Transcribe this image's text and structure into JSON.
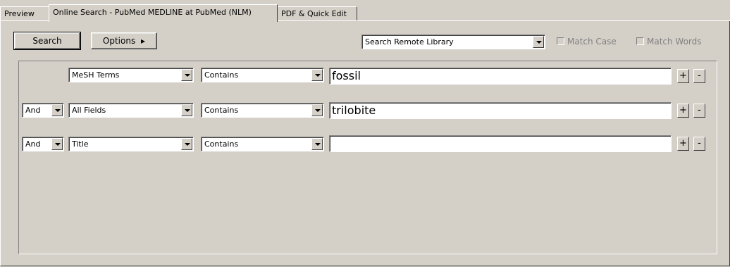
{
  "tabs": [
    {
      "label": "Preview"
    },
    {
      "label": "Online Search - PubMed MEDLINE at PubMed (NLM)",
      "active": true
    },
    {
      "label": "PDF & Quick Edit"
    }
  ],
  "toolbar": {
    "search_label": "Search",
    "options_label": "Options",
    "options_arrow": "▸",
    "library_select": "Search Remote Library",
    "match_case_label": "Match Case",
    "match_words_label": "Match Words"
  },
  "rows": [
    {
      "bool": "",
      "field": "MeSH Terms",
      "operator": "Contains",
      "value": "fossil",
      "plus": "+",
      "minus": "-"
    },
    {
      "bool": "And",
      "field": "All Fields",
      "operator": "Contains",
      "value": "trilobite",
      "plus": "+",
      "minus": "-"
    },
    {
      "bool": "And",
      "field": "Title",
      "operator": "Contains",
      "value": "",
      "plus": "+",
      "minus": "-"
    }
  ]
}
